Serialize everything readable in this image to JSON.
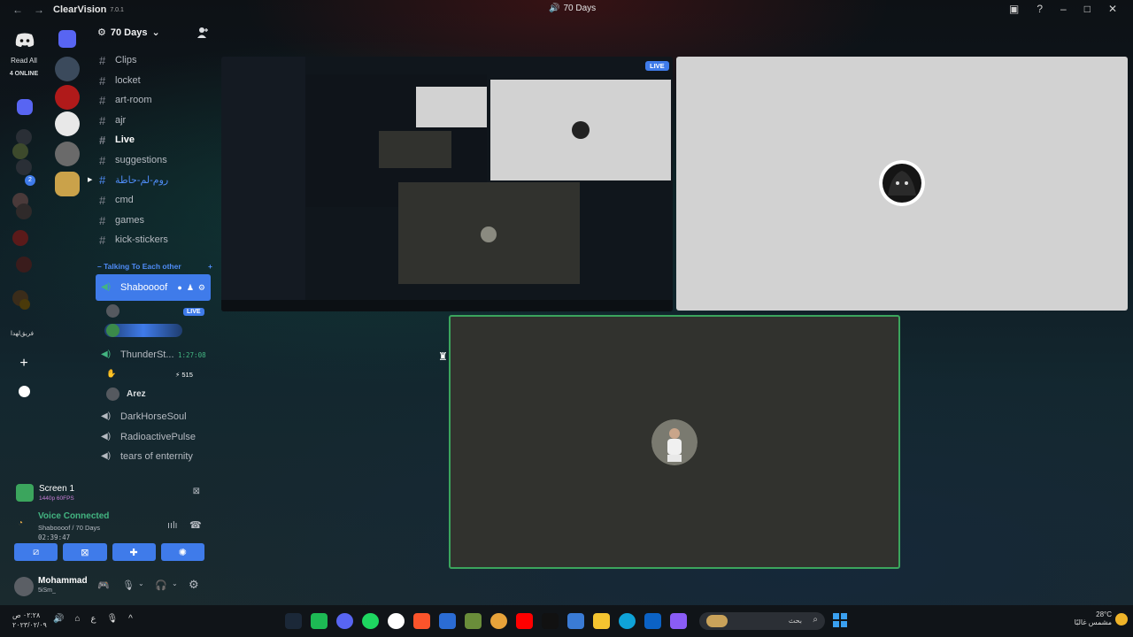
{
  "titlebar": {
    "app_name": "ClearVision",
    "version": "7.0.1",
    "title": "70 Days"
  },
  "rail": {
    "read_all": "Read All",
    "online": "4 ONLINE",
    "dm_badge": "2",
    "text_logo": "ﻓﺮﻳﻖﻟﻬﺪﺍ"
  },
  "guild": {
    "name": "70 Days"
  },
  "channels": [
    {
      "name": "Clips"
    },
    {
      "name": "locket"
    },
    {
      "name": "art-room"
    },
    {
      "name": "ajr"
    },
    {
      "name": "Live"
    },
    {
      "name": "suggestions"
    },
    {
      "name": "روم-لم-حاطة"
    },
    {
      "name": "cmd"
    },
    {
      "name": "games"
    },
    {
      "name": "kick-stickers"
    }
  ],
  "category": {
    "name": "Talking To Each other",
    "plus": "+"
  },
  "voice": {
    "active_channel": "Shaboooof",
    "live_badge": "LIVE",
    "channel2": "ThunderSt...",
    "channel2_timer": "1:27:08",
    "score": "515",
    "user_arez": "Arez",
    "channel3": "DarkHorseSoul",
    "channel4": "RadioactivePulse",
    "channel5": "tears of enternity"
  },
  "panel": {
    "screen_title": "Screen 1",
    "screen_sub": "1440p 60FPS",
    "vc_status": "Voice Connected",
    "vc_location": "Shaboooof / 70 Days",
    "vc_time": "02:39:47",
    "user_name": "Mohammad",
    "user_status": "5iSm_"
  },
  "stage": {
    "live_tag": "LIVE"
  },
  "taskbar": {
    "clock_time": "٠٢:٢٨ ص",
    "clock_date": "٢٠٢٣/٠٢/٠٩",
    "lang": "ع",
    "search": "بحث",
    "temp": "28°C",
    "weather": "مشمس غالبًا"
  },
  "colors": {
    "accent": "#3f7bea",
    "voice_green": "#43b581",
    "sidebar_text": "#b5bac1"
  }
}
